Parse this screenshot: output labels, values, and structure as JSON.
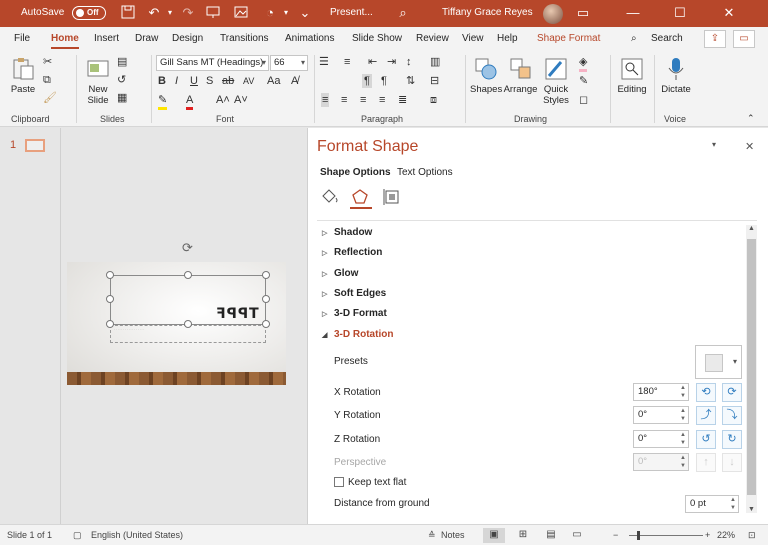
{
  "titlebar": {
    "autosave_label": "AutoSave",
    "autosave_state": "Off",
    "doc_title": "Present...",
    "user_name": "Tiffany Grace Reyes"
  },
  "tabs": [
    "File",
    "Home",
    "Insert",
    "Draw",
    "Design",
    "Transitions",
    "Animations",
    "Slide Show",
    "Review",
    "View",
    "Help",
    "Shape Format"
  ],
  "active_tab": "Home",
  "search_label": "Search",
  "ribbon": {
    "clipboard": {
      "paste": "Paste",
      "group": "Clipboard"
    },
    "slides": {
      "new_slide_1": "New",
      "new_slide_2": "Slide",
      "group": "Slides"
    },
    "font": {
      "font_name": "Gill Sans MT (Headings)",
      "font_size": "66",
      "group": "Font"
    },
    "paragraph": {
      "group": "Paragraph"
    },
    "drawing": {
      "shapes": "Shapes",
      "arrange": "Arrange",
      "quick_1": "Quick",
      "quick_2": "Styles",
      "group": "Drawing"
    },
    "editing": {
      "label": "Editing"
    },
    "voice": {
      "dictate": "Dictate",
      "group": "Voice"
    }
  },
  "thumbnail": {
    "number": "1"
  },
  "slide": {
    "mirrored_text": "TPPF"
  },
  "pane": {
    "title": "Format Shape",
    "tabs": [
      "Shape Options",
      "Text Options"
    ],
    "sections": [
      "Shadow",
      "Reflection",
      "Glow",
      "Soft Edges",
      "3-D Format",
      "3-D Rotation"
    ],
    "rotation": {
      "presets_label": "Presets",
      "x_label": "X Rotation",
      "x_value": "180°",
      "y_label": "Y Rotation",
      "y_value": "0°",
      "z_label": "Z Rotation",
      "z_value": "0°",
      "perspective_label": "Perspective",
      "perspective_value": "0°",
      "keep_flat_label": "Keep text flat",
      "distance_label": "Distance from ground",
      "distance_value": "0 pt"
    }
  },
  "status": {
    "slide_counter": "Slide 1 of 1",
    "language": "English (United States)",
    "notes": "Notes",
    "zoom": "22%"
  },
  "colors": {
    "accent": "#b7472a"
  }
}
